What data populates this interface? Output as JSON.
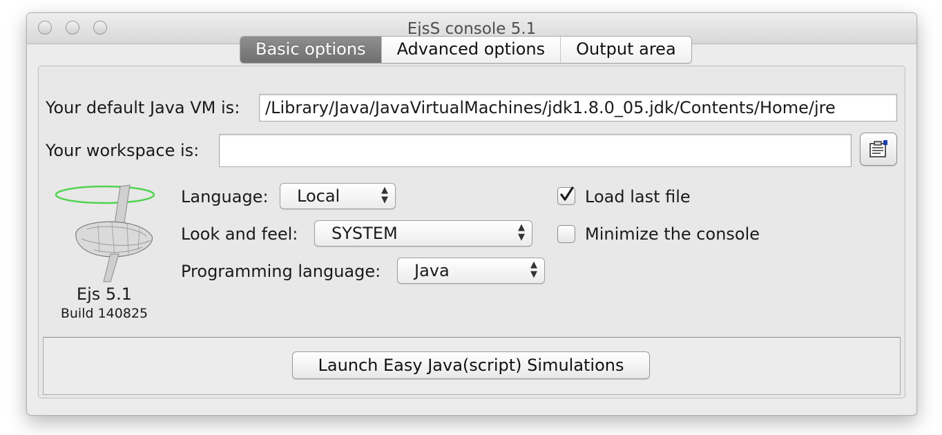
{
  "window": {
    "title": "EjsS console 5.1"
  },
  "tabs": [
    {
      "label": "Basic options",
      "active": true
    },
    {
      "label": "Advanced options",
      "active": false
    },
    {
      "label": "Output area",
      "active": false
    }
  ],
  "java_vm": {
    "label": "Your default Java VM is:",
    "value": "/Library/Java/JavaVirtualMachines/jdk1.8.0_05.jdk/Contents/Home/jre"
  },
  "workspace": {
    "label": "Your workspace is:",
    "value": "",
    "browse_icon": "folder-browse-icon"
  },
  "language": {
    "label": "Language:",
    "value": "Local"
  },
  "look_and_feel": {
    "label": "Look and feel:",
    "value": "SYSTEM"
  },
  "programming_language": {
    "label": "Programming language:",
    "value": "Java"
  },
  "options": {
    "load_last_file": {
      "label": "Load last file",
      "checked": true
    },
    "minimize_console": {
      "label": "Minimize the console",
      "checked": false
    }
  },
  "logo": {
    "name": "Ejs 5.1",
    "build": "Build 140825",
    "icon": "ejs-spinning-top-logo"
  },
  "launch_button": {
    "label": "Launch Easy Java(script) Simulations"
  }
}
